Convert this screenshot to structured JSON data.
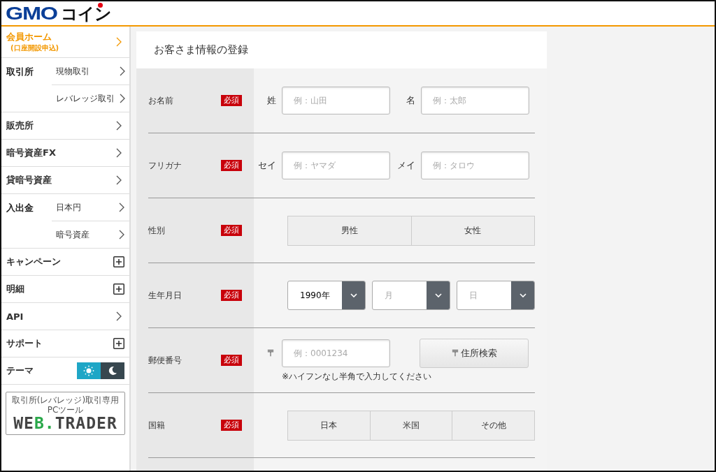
{
  "header": {
    "logo": {
      "latin": "GMO",
      "kana": "コイン"
    }
  },
  "sidebar": {
    "items": [
      {
        "kind": "link",
        "label": "会員ホーム",
        "sublabel": "(口座開設申込)",
        "selected": true
      },
      {
        "kind": "group",
        "label": "取引所",
        "selected": false,
        "children": [
          {
            "label": "現物取引"
          },
          {
            "label": "レバレッジ取引"
          }
        ]
      },
      {
        "kind": "link",
        "label": "販売所",
        "selected": false
      },
      {
        "kind": "link",
        "label": "暗号資産FX",
        "selected": false
      },
      {
        "kind": "link",
        "label": "貸暗号資産",
        "selected": false
      },
      {
        "kind": "group",
        "label": "入出金",
        "selected": false,
        "children": [
          {
            "label": "日本円"
          },
          {
            "label": "暗号資産"
          }
        ]
      },
      {
        "kind": "expandable",
        "label": "キャンペーン",
        "selected": false
      },
      {
        "kind": "expandable",
        "label": "明細",
        "selected": false
      },
      {
        "kind": "link",
        "label": "API",
        "selected": false
      },
      {
        "kind": "expandable",
        "label": "サポート",
        "selected": false
      }
    ],
    "theme": {
      "label": "テーマ",
      "options": [
        {
          "kind": "light",
          "selected": true
        },
        {
          "kind": "dark",
          "selected": false
        }
      ]
    },
    "banner": {
      "caption": "取引所(レバレッジ)取引専用PCツール",
      "logo_parts": [
        {
          "text": "WE",
          "accent": false
        },
        {
          "text": "B.",
          "accent": true
        },
        {
          "text": "TRADER",
          "accent": false
        }
      ]
    }
  },
  "form": {
    "title": "お客さま情報の登録",
    "rows": [
      {
        "kind": "text_pair",
        "label": "お名前",
        "required": "必須",
        "fields": [
          {
            "label": "姓",
            "placeholder": "例：山田"
          },
          {
            "label": "名",
            "placeholder": "例：太郎"
          }
        ]
      },
      {
        "kind": "text_pair",
        "label": "フリガナ",
        "required": "必須",
        "fields": [
          {
            "label": "セイ",
            "placeholder": "例：ヤマダ"
          },
          {
            "label": "メイ",
            "placeholder": "例：タロウ"
          }
        ]
      },
      {
        "kind": "segmented",
        "label": "性別",
        "required": "必須",
        "options": [
          {
            "label": "男性",
            "selected": false
          },
          {
            "label": "女性",
            "selected": false
          }
        ]
      },
      {
        "kind": "date_selects",
        "label": "生年月日",
        "required": "必須",
        "selects": [
          {
            "value": "1990年"
          },
          {
            "placeholder": "月"
          },
          {
            "placeholder": "日"
          }
        ]
      },
      {
        "kind": "postal",
        "label": "郵便番号",
        "required": "必須",
        "prefix": "〒",
        "placeholder": "例：0001234",
        "button": "〒住所検索",
        "note": "※ハイフンなし半角で入力してください"
      },
      {
        "kind": "segmented",
        "label": "国籍",
        "required": "必須",
        "options": [
          {
            "label": "日本",
            "selected": false
          },
          {
            "label": "米国",
            "selected": false
          },
          {
            "label": "その他",
            "selected": false
          }
        ]
      },
      {
        "kind": "blank"
      }
    ]
  }
}
